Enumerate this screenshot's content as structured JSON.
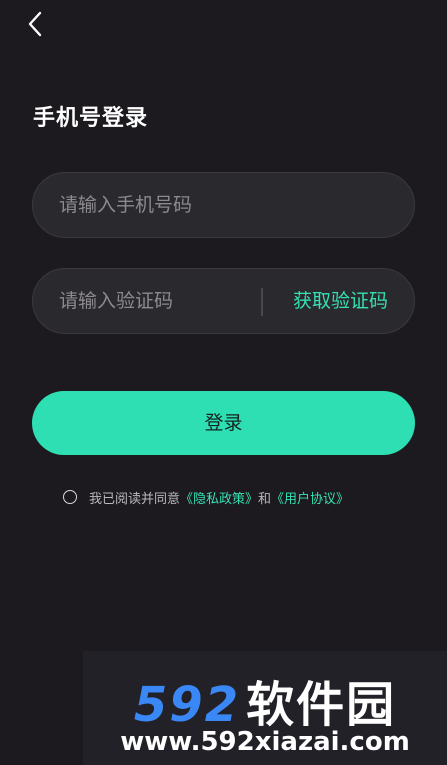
{
  "header": {
    "back_icon": "chevron-left-icon",
    "title": "手机号登录"
  },
  "form": {
    "phone_placeholder": "请输入手机号码",
    "phone_value": "",
    "code_placeholder": "请输入验证码",
    "code_value": "",
    "get_code_label": "获取验证码",
    "login_label": "登录"
  },
  "agreement": {
    "prefix": "我已阅读并同意",
    "privacy_link": "《隐私政策》",
    "conjunction": "和",
    "terms_link": "《用户协议》",
    "checked": false
  },
  "watermark": {
    "brand_number": "592",
    "brand_text": "软件园",
    "url": "www.592xiazai.com"
  },
  "colors": {
    "background": "#1c1a1e",
    "accent": "#2fdfb4",
    "field": "#2a292d",
    "watermark_blue": "#3a88f5"
  }
}
